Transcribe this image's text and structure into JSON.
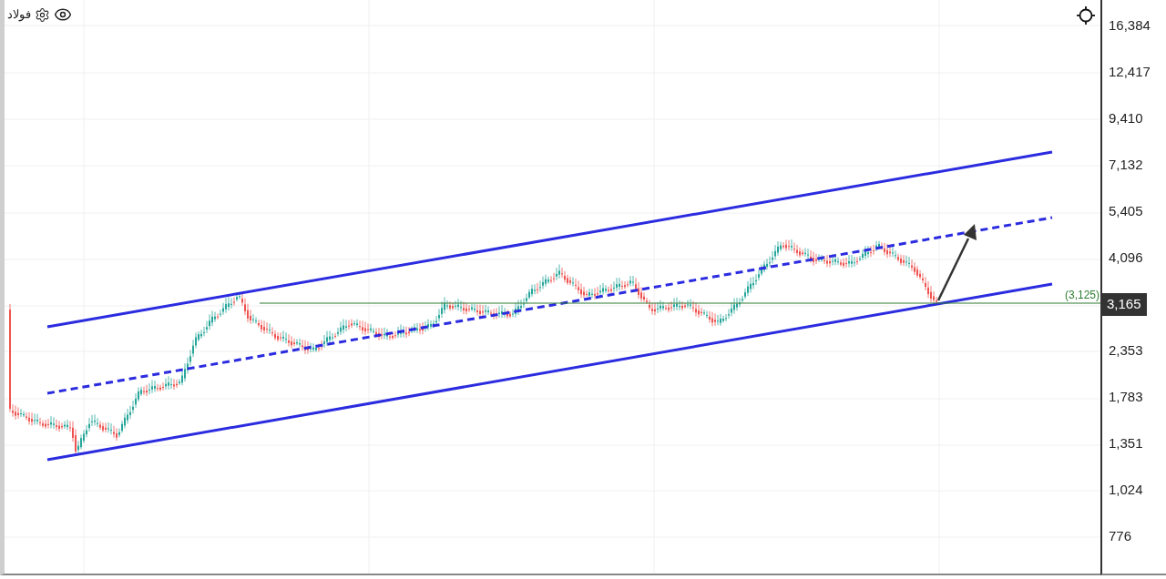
{
  "legend": {
    "symbol": "فولاد",
    "visible": true
  },
  "green_level_label": "(3,125)",
  "price_axis": [
    {
      "kind": "tick",
      "label": "16,384"
    },
    {
      "kind": "tick",
      "label": "12,417"
    },
    {
      "kind": "tick",
      "label": "9,410"
    },
    {
      "kind": "tick",
      "label": "7,132"
    },
    {
      "kind": "tick",
      "label": "5,405"
    },
    {
      "kind": "tick",
      "label": "4,096"
    },
    {
      "kind": "current",
      "label": "3,165"
    },
    {
      "kind": "tick",
      "label": "2,353"
    },
    {
      "kind": "tick",
      "label": "1,783"
    },
    {
      "kind": "tick",
      "label": "1,351"
    },
    {
      "kind": "tick",
      "label": "1,024"
    },
    {
      "kind": "tick",
      "label": "776"
    }
  ]
}
